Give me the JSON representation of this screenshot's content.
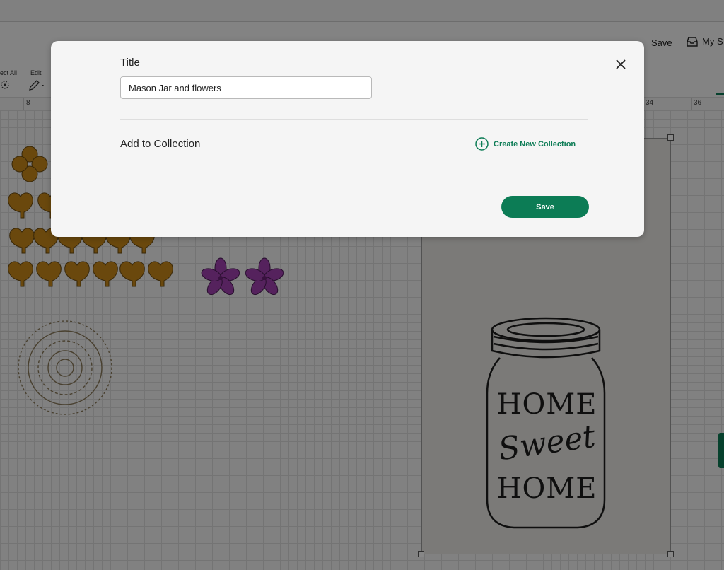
{
  "header": {
    "save_label": "Save",
    "my_projects_label": "My S"
  },
  "toolbar": {
    "select_all_label": "ect All",
    "edit_label": "Edit"
  },
  "ruler": {
    "ticks": [
      "8",
      "34",
      "36"
    ]
  },
  "canvas": {
    "jar_text_line1": "HOME",
    "jar_text_line2": "Sweet",
    "jar_text_line3": "HOME"
  },
  "modal": {
    "title_label": "Title",
    "title_value": "Mason Jar and flowers",
    "add_to_collection_label": "Add to Collection",
    "create_collection_label": "Create New Collection",
    "save_label": "Save",
    "close_icon": "close-icon"
  },
  "colors": {
    "accent": "#0c7c55",
    "heart_fill": "#c8891a",
    "flower_fill": "#a040b0"
  }
}
